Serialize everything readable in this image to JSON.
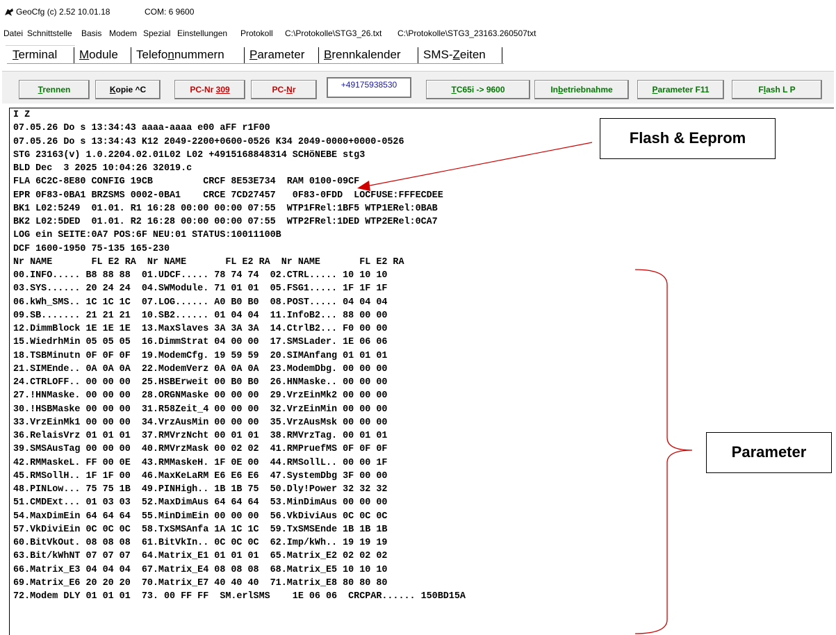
{
  "window": {
    "app_title": "GeoCfg  (c) 2.52 10.01.18",
    "com_status": "COM: 6 9600"
  },
  "menu": [
    "Datei",
    "Schnittstelle",
    "Basis",
    "Modem",
    "Spezial",
    "Einstellungen",
    "Protokoll",
    "C:\\Protokolle\\STG3_26.txt",
    "C:\\Protokolle\\STG3_23163.260507txt"
  ],
  "tabs": [
    {
      "pre": "",
      "u": "T",
      "post": "erminal"
    },
    {
      "pre": "",
      "u": "M",
      "post": "odule"
    },
    {
      "pre": "Telefo",
      "u": "n",
      "post": "nummern"
    },
    {
      "pre": "",
      "u": "P",
      "post": "arameter"
    },
    {
      "pre": "",
      "u": "B",
      "post": "rennkalender"
    },
    {
      "pre": "SMS-",
      "u": "Z",
      "post": "eiten"
    }
  ],
  "buttons": {
    "trennen": {
      "u": "T",
      "post": "rennen"
    },
    "kopie": {
      "pre": "",
      "u": "K",
      "post": "opie ^C"
    },
    "pcnr309": {
      "pre": "PC-Nr ",
      "u": "309",
      "post": ""
    },
    "pcnr": {
      "pre": "PC-",
      "u": "N",
      "post": "r"
    },
    "phone": "+49175938530",
    "tc65i": {
      "pre": "",
      "u": "T",
      "post": "C65i -> 9600"
    },
    "inbetrieb": {
      "pre": "In",
      "u": "b",
      "post": "etriebnahme"
    },
    "parameter": {
      "pre": "",
      "u": "P",
      "post": "arameter F11"
    },
    "flash": {
      "pre": "F",
      "u": "l",
      "post": "ash L P"
    }
  },
  "terminal_lines": [
    "I Z",
    "07.05.26 Do s 13:34:43 aaaa-aaaa e00 aFF r1F00",
    "07.05.26 Do s 13:34:43 K12 2049-2200+0600-0526 K34 2049-0000+0000-0526",
    "STG 23163(v) 1.0.2204.02.01L02 L02 +4915168848314 SCHöNEBE stg3",
    "BLD Dec  3 2025 10:04:26 32019.c",
    "FLA 6C2C-8E80 CONFIG 19CB         CRCF 8E53E734  RAM 0100-09CF",
    "EPR 0F83-0BA1 BRZSMS 0002-0BA1    CRCE 7CD27457   0F83-0FDD  LOCFUSE:FFFECDEE",
    "BK1 L02:5249  01.01. R1 16:28 00:00 00:00 07:55  WTP1FRel:1BF5 WTP1ERel:0BAB",
    "BK2 L02:5DED  01.01. R2 16:28 00:00 00:00 07:55  WTP2FRel:1DED WTP2ERel:0CA7",
    "LOG ein SEITE:0A7 POS:6F NEU:01 STATUS:10011100B",
    "DCF 1600-1950 75-135 165-230",
    "Nr NAME       FL E2 RA  Nr NAME       FL E2 RA  Nr NAME       FL E2 RA",
    "00.INFO..... B8 88 88  01.UDCF..... 78 74 74  02.CTRL..... 10 10 10",
    "03.SYS...... 20 24 24  04.SWModule. 71 01 01  05.FSG1..... 1F 1F 1F",
    "06.kWh_SMS.. 1C 1C 1C  07.LOG...... A0 B0 B0  08.POST..... 04 04 04",
    "09.SB....... 21 21 21  10.SB2...... 01 04 04  11.InfoB2... 88 00 00",
    "12.DimmBlock 1E 1E 1E  13.MaxSlaves 3A 3A 3A  14.CtrlB2... F0 00 00",
    "15.WiedrhMin 05 05 05  16.DimmStrat 04 00 00  17.SMSLader. 1E 06 06",
    "18.TSBMinutn 0F 0F 0F  19.ModemCfg. 19 59 59  20.SIMAnfang 01 01 01",
    "21.SIMEnde.. 0A 0A 0A  22.ModemVerz 0A 0A 0A  23.ModemDbg. 00 00 00",
    "24.CTRLOFF.. 00 00 00  25.HSBErweit 00 B0 B0  26.HNMaske.. 00 00 00",
    "27.!HNMaske. 00 00 00  28.ORGNMaske 00 00 00  29.VrzEinMk2 00 00 00",
    "30.!HSBMaske 00 00 00  31.R58Zeit_4 00 00 00  32.VrzEinMin 00 00 00",
    "33.VrzEinMk1 00 00 00  34.VrzAusMin 00 00 00  35.VrzAusMsk 00 00 00",
    "36.RelaisVrz 01 01 01  37.RMVrzNcht 00 01 01  38.RMVrzTag. 00 01 01",
    "39.SMSAusTag 00 00 00  40.RMVrzMask 00 02 02  41.RMPruefMS 0F 0F 0F",
    "42.RMMaskeL. FF 00 0E  43.RMMaskeH. 1F 0E 00  44.RMSollL.. 00 00 1F",
    "45.RMSollH.. 1F 1F 00  46.MaxKeLaRM E6 E6 E6  47.SystemDbg 3F 00 00",
    "48.PINLow... 75 75 1B  49.PINHigh.. 1B 1B 75  50.Dly!Power 32 32 32",
    "51.CMDExt... 01 03 03  52.MaxDimAus 64 64 64  53.MinDimAus 00 00 00",
    "54.MaxDimEin 64 64 64  55.MinDimEin 00 00 00  56.VkDiviAus 0C 0C 0C",
    "57.VkDiviEin 0C 0C 0C  58.TxSMSAnfa 1A 1C 1C  59.TxSMSEnde 1B 1B 1B",
    "60.BitVkOut. 08 08 08  61.BitVkIn.. 0C 0C 0C  62.Imp/kWh.. 19 19 19",
    "63.Bit/kWhNT 07 07 07  64.Matrix_E1 01 01 01  65.Matrix_E2 02 02 02",
    "66.Matrix_E3 04 04 04  67.Matrix_E4 08 08 08  68.Matrix_E5 10 10 10",
    "69.Matrix_E6 20 20 20  70.Matrix_E7 40 40 40  71.Matrix_E8 80 80 80",
    "72.Modem DLY 01 01 01  73. 00 FF FF  SM.erlSMS    1E 06 06  CRCPAR...... 150BD15A"
  ],
  "annotations": {
    "flash_eeprom": "Flash & Eeprom",
    "parameter": "Parameter",
    "arrow_color": "#d00000"
  }
}
